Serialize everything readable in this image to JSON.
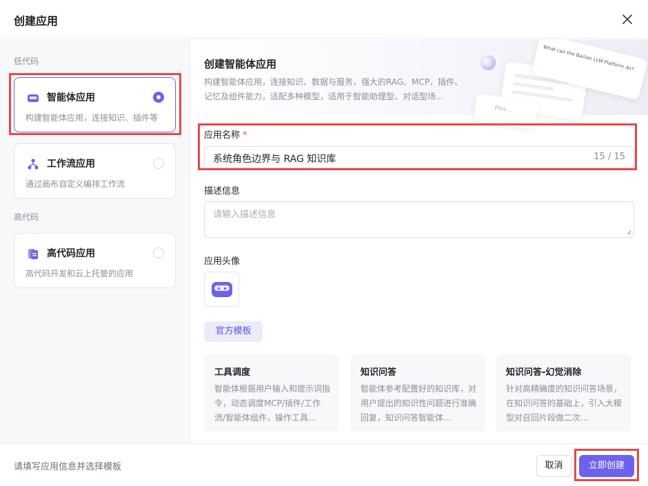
{
  "dialog": {
    "title": "创建应用",
    "close_icon": "close-icon"
  },
  "sidebar": {
    "low_code_label": "低代码",
    "high_code_label": "高代码",
    "apps": [
      {
        "title": "智能体应用",
        "desc": "构建智能体应用，连接知识、插件等",
        "icon": "agent-icon",
        "selected": true
      },
      {
        "title": "工作流应用",
        "desc": "通过画布自定义编排工作流",
        "icon": "workflow-icon",
        "selected": false
      },
      {
        "title": "高代码应用",
        "desc": "高代码开发和云上托管的应用",
        "icon": "document-icon",
        "selected": false
      }
    ]
  },
  "banner": {
    "title": "创建智能体应用",
    "desc": "构建智能体应用，连接知识、数据与服务，强大的RAG、MCP、插件、记忆及组件能力，适配多种模型，适用于智能助理型、对话型场...",
    "deco_text": "What can the Bailian LLM Platform do?",
    "deco_placeholder": "Plea..."
  },
  "form": {
    "name_label": "应用名称",
    "required_mark": "*",
    "name_value": "系统角色边界与 RAG 知识库",
    "name_count": "15 / 15",
    "desc_label": "描述信息",
    "desc_placeholder": "请输入描述信息",
    "avatar_label": "应用头像"
  },
  "templates": {
    "tab_label": "官方模板",
    "items": [
      {
        "title": "工具调度",
        "desc": "智能体根据用户输入和提示词指令，动态调度MCP/插件/工作流/智能体组件，操作工具..."
      },
      {
        "title": "知识问答",
        "desc": "智能体参考配置好的知识库，对用户提出的知识性问题进行准确回复，知识问答智能体..."
      },
      {
        "title": "知识问答-幻觉消除",
        "desc": "针对高精确度的知识问答场景，在知识问答的基础上，引入大模型对召回片段做二次..."
      }
    ]
  },
  "footer": {
    "hint": "请填写应用信息并选择模板",
    "cancel_label": "取消",
    "create_label": "立即创建"
  },
  "colors": {
    "accent": "#6c62ee",
    "highlight": "#e84749"
  }
}
